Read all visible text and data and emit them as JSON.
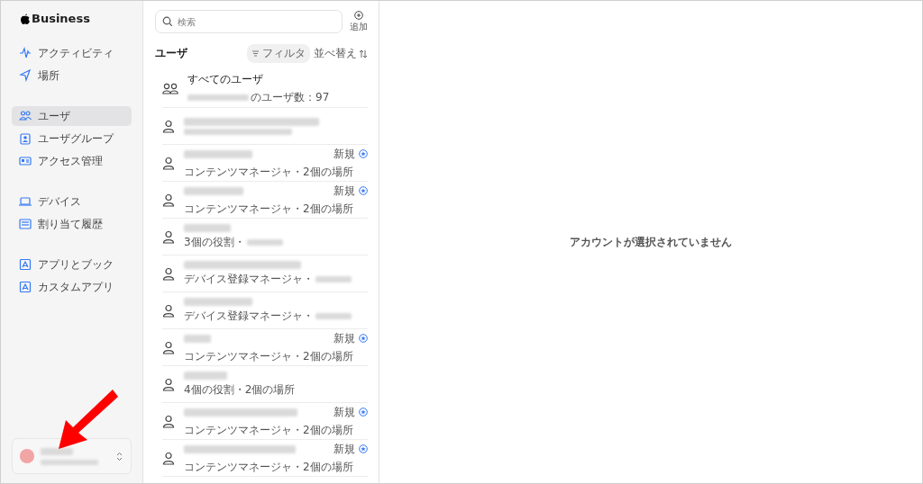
{
  "sidebar": {
    "logo": "Business",
    "groups": [
      {
        "items": [
          {
            "label": "アクティビティ",
            "selected": false
          },
          {
            "label": "場所",
            "selected": false
          }
        ]
      },
      {
        "items": [
          {
            "label": "ユーザ",
            "selected": true
          },
          {
            "label": "ユーザグループ",
            "selected": false
          },
          {
            "label": "アクセス管理",
            "selected": false
          }
        ]
      },
      {
        "items": [
          {
            "label": "デバイス",
            "selected": false
          },
          {
            "label": "割り当て履歴",
            "selected": false
          }
        ]
      },
      {
        "items": [
          {
            "label": "アプリとブック",
            "selected": false
          },
          {
            "label": "カスタムアプリ",
            "selected": false
          }
        ]
      }
    ]
  },
  "list": {
    "search": {
      "placeholder": "検索"
    },
    "add_label": "追加",
    "title": "ユーザ",
    "filter_label": "フィルタ",
    "sort_label": "並べ替え",
    "rows": [
      {
        "kind": "all",
        "name": "すべてのユーザ",
        "subtitle": "のユーザ数：97"
      },
      {
        "kind": "user",
        "subtitle": "",
        "redacted_tail": true
      },
      {
        "kind": "user",
        "subtitle": "コンテンツマネージャ・2個の場所",
        "redacted_tail": false,
        "badge": "新規"
      },
      {
        "kind": "user",
        "subtitle": "コンテンツマネージャ・2個の場所",
        "redacted_tail": false,
        "badge": "新規"
      },
      {
        "kind": "user",
        "subtitle": "3個の役割・",
        "redacted_tail": true
      },
      {
        "kind": "user",
        "subtitle": "デバイス登録マネージャ・",
        "redacted_tail": true
      },
      {
        "kind": "user",
        "subtitle": "デバイス登録マネージャ・",
        "redacted_tail": true
      },
      {
        "kind": "user",
        "subtitle": "コンテンツマネージャ・2個の場所",
        "redacted_tail": false,
        "badge": "新規"
      },
      {
        "kind": "user",
        "subtitle": "4個の役割・2個の場所",
        "redacted_tail": false
      },
      {
        "kind": "user",
        "subtitle": "コンテンツマネージャ・2個の場所",
        "redacted_tail": false,
        "badge": "新規"
      },
      {
        "kind": "user",
        "subtitle": "コンテンツマネージャ・2個の場所",
        "redacted_tail": false,
        "badge": "新規"
      }
    ]
  },
  "detail": {
    "empty_message": "アカウントが選択されていません"
  }
}
